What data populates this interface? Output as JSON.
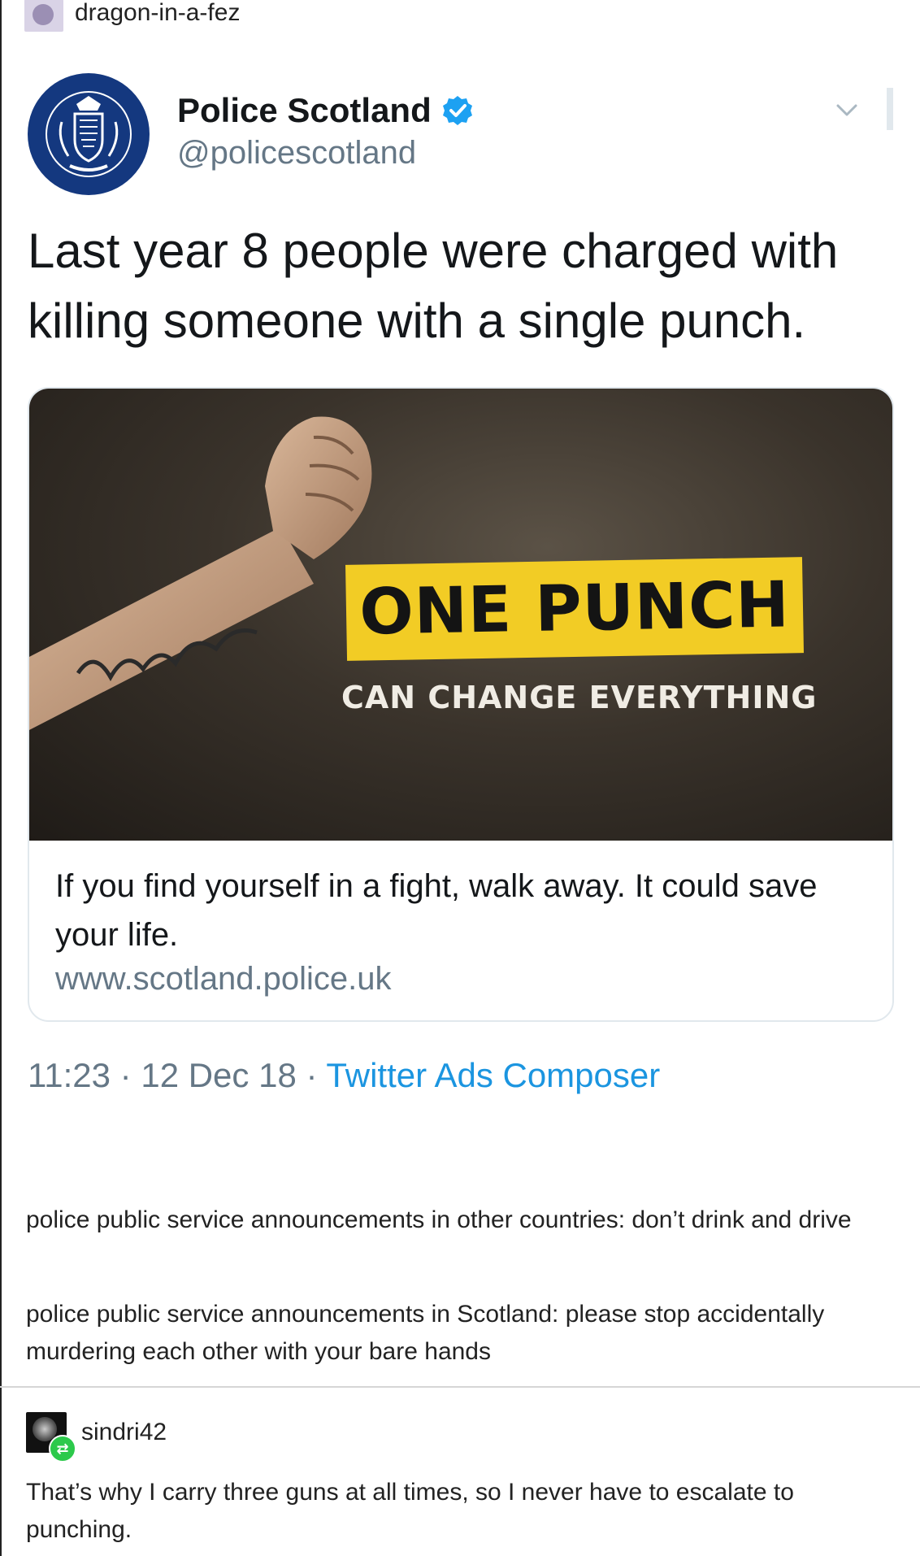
{
  "op": {
    "username": "dragon-in-a-fez"
  },
  "tweet": {
    "display_name": "Police Scotland",
    "handle": "@policescotland",
    "text": "Last year 8 people were charged with killing someone with a single punch.",
    "card": {
      "headline": "ONE PUNCH",
      "subline": "CAN CHANGE EVERYTHING",
      "tattoo": "Shame",
      "description": "If you find yourself in a fight, walk away. It could save your life.",
      "url": "www.scotland.police.uk"
    },
    "time": "11:23",
    "date": "12 Dec 18",
    "separator": "·",
    "source": "Twitter Ads Composer",
    "colors": {
      "brand_blue": "#14387f",
      "verified": "#1da1f2",
      "link": "#1b95e0",
      "muted": "#657786",
      "highlight_yellow": "#f2cc25"
    },
    "icons": {
      "avatar": "police-scotland-crest-icon",
      "verified": "verified-badge-icon",
      "menu": "chevron-down-icon"
    }
  },
  "comments": {
    "p1": "police public service announcements in other countries: don’t drink and drive",
    "p2": "police public service announcements in Scotland: please stop accidentally murdering each other with your bare hands"
  },
  "reblog": {
    "username": "sindri42",
    "text": "That’s why I carry three guns at all times, so I never have to escalate to punching.",
    "badge_icon": "reblog-icon"
  }
}
